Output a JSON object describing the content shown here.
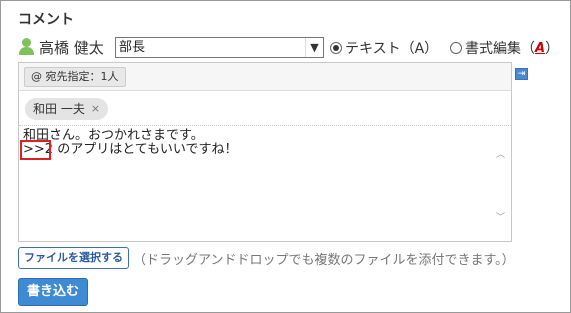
{
  "section": {
    "title": "コメント"
  },
  "user": {
    "icon": "person-icon",
    "name": "高橋 健太"
  },
  "position_select": {
    "value": "部長"
  },
  "format": {
    "text_option": {
      "label": "テキスト（A）",
      "checked": true
    },
    "rich_option": {
      "label": "書式編集（",
      "closing": "）",
      "icon_label": "A",
      "checked": false
    }
  },
  "editor": {
    "mention_button": "@ 宛先指定：1人",
    "recipient_chip": {
      "name": "和田 一夫",
      "remove": "×"
    },
    "body_lines": [
      "和田さん。おつかれさまです。",
      ">>2 のアプリはとてもいいですね！"
    ]
  },
  "file": {
    "button_label": "ファイルを選択する",
    "hint": "（ドラッグアンドドロップでも複数のファイルを添付できます。）"
  },
  "submit": {
    "label": "書き込む"
  },
  "colors": {
    "accent": "#3f8bd3",
    "highlight": "#e02020",
    "user_icon": "#7fc15a"
  }
}
